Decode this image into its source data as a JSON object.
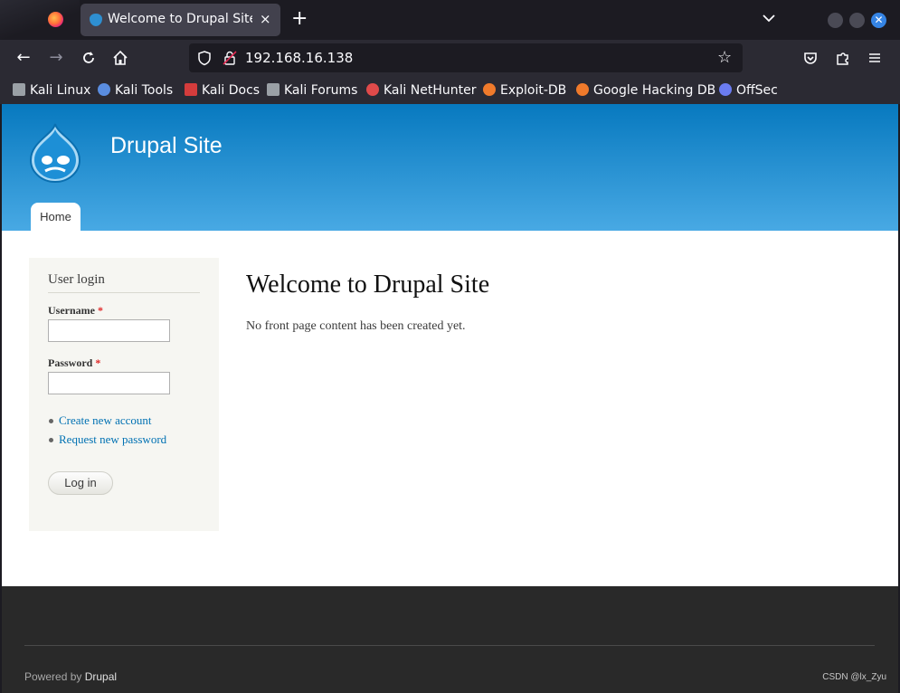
{
  "browser": {
    "tab_title": "Welcome to Drupal Site | Drupal Site",
    "tab_close": "×",
    "new_tab": "+",
    "url": "192.168.16.138",
    "bookmarks": [
      {
        "label": "Kali Linux",
        "icon": "kali-dragon-icon",
        "color": "#9aa0a6"
      },
      {
        "label": "Kali Tools",
        "icon": "kali-tools-icon",
        "color": "#5a8de0"
      },
      {
        "label": "Kali Docs",
        "icon": "kali-docs-icon",
        "color": "#d43c3c"
      },
      {
        "label": "Kali Forums",
        "icon": "kali-forums-icon",
        "color": "#9aa0a6"
      },
      {
        "label": "Kali NetHunter",
        "icon": "nethunter-icon",
        "color": "#e04a4a"
      },
      {
        "label": "Exploit-DB",
        "icon": "exploit-db-icon",
        "color": "#f07a2b"
      },
      {
        "label": "Google Hacking DB",
        "icon": "ghdb-icon",
        "color": "#f07a2b"
      },
      {
        "label": "OffSec",
        "icon": "offsec-icon",
        "color": "#6b7cf0"
      }
    ]
  },
  "site": {
    "name": "Drupal Site",
    "nav": {
      "home": "Home"
    }
  },
  "login": {
    "heading": "User login",
    "username_label": "Username",
    "password_label": "Password",
    "required_mark": "*",
    "links": [
      "Create new account",
      "Request new password"
    ],
    "submit": "Log in"
  },
  "main": {
    "title": "Welcome to Drupal Site",
    "text": "No front page content has been created yet."
  },
  "footer": {
    "powered_prefix": "Powered by",
    "powered_link": "Drupal",
    "credit": "CSDN @lx_Zyu"
  },
  "colors": {
    "header_top": "#0779bf",
    "header_bottom": "#48a9e4",
    "link": "#0071b3",
    "footer_bg": "#292929"
  }
}
